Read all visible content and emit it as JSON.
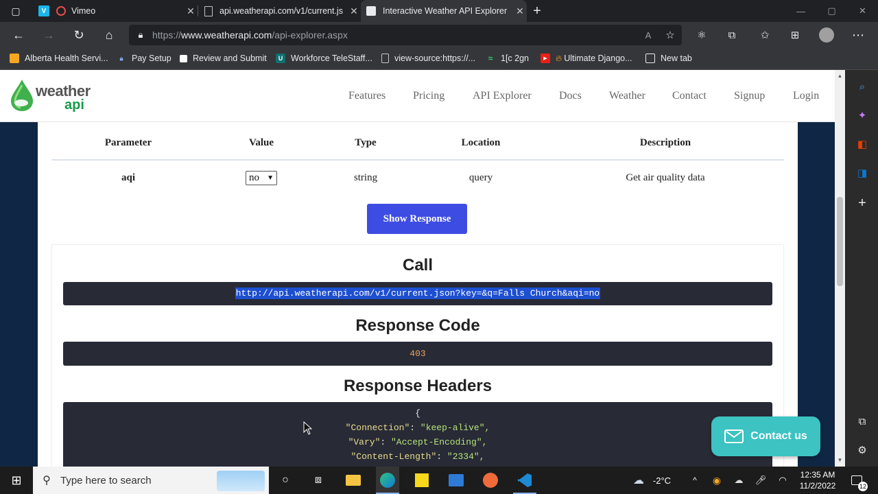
{
  "browser": {
    "tabs": [
      {
        "title": "Vimeo",
        "favicon_letter": "V",
        "favicon_color": "#1ab7ea"
      },
      {
        "title": "api.weatherapi.com/v1/current.js"
      },
      {
        "title": "Interactive Weather API Explorer",
        "active": true
      }
    ],
    "new_tab_symbol": "+",
    "url_prefix": "https://",
    "url_host": "www.weatherapi.com",
    "url_path": "/api-explorer.aspx",
    "bookmarks": [
      {
        "label": "Alberta Health Servi..."
      },
      {
        "label": "Pay Setup"
      },
      {
        "label": "Review and Submit"
      },
      {
        "label": "Workforce TeleStaff..."
      },
      {
        "label": "view-source:https://..."
      },
      {
        "label": "1[c 2gn"
      },
      {
        "label": "Ultimate Django..."
      },
      {
        "label": "New tab"
      }
    ]
  },
  "site": {
    "logo_word1": "weather",
    "logo_word2": "api",
    "nav": [
      "Features",
      "Pricing",
      "API Explorer",
      "Docs",
      "Weather",
      "Contact",
      "Signup",
      "Login"
    ]
  },
  "params_table": {
    "headers": [
      "Parameter",
      "Value",
      "Type",
      "Location",
      "Description"
    ],
    "row": {
      "parameter": "aqi",
      "value": "no",
      "type": "string",
      "location": "query",
      "description": "Get air quality data"
    }
  },
  "show_response_label": "Show Response",
  "call": {
    "title": "Call",
    "url": "http://api.weatherapi.com/v1/current.json?key=&q=Falls Church&aqi=no"
  },
  "response_code": {
    "title": "Response Code",
    "value": "403"
  },
  "response_headers": {
    "title": "Response Headers",
    "open_brace": "{",
    "lines": [
      {
        "key": "\"Connection\"",
        "value": "\"keep-alive\","
      },
      {
        "key": "\"Vary\"",
        "value": "\"Accept-Encoding\","
      },
      {
        "key": "\"Content-Length\"",
        "value": "\"2334\","
      }
    ]
  },
  "contact_us_label": "Contact us",
  "taskbar": {
    "search_placeholder": "Type here to search",
    "weather": "-2°C",
    "time": "12:35 AM",
    "date": "11/2/2022",
    "notification_count": "12"
  },
  "colors": {
    "accent_button": "#3d4de3",
    "contact_button": "#3cc3c2",
    "code_bg": "#282a36",
    "status_code": "#e9a35d"
  }
}
